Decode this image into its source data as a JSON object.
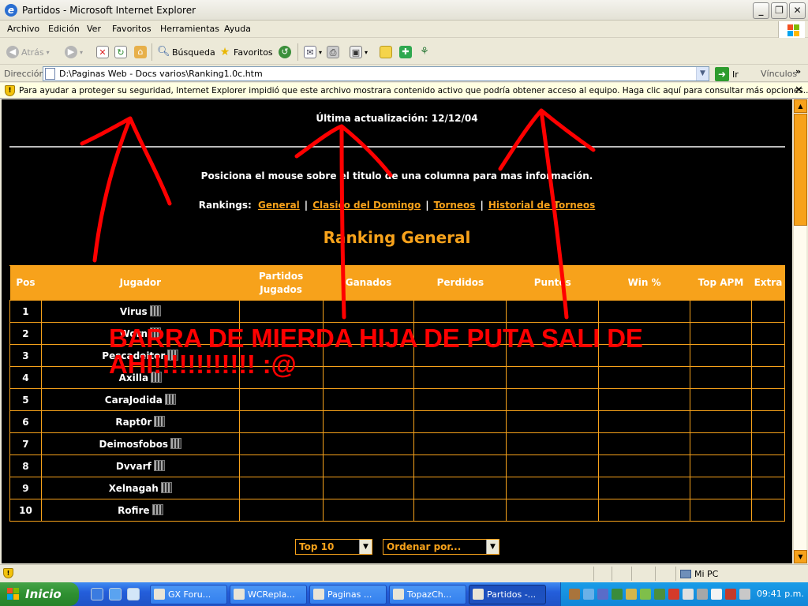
{
  "window": {
    "title": "Partidos - Microsoft Internet Explorer"
  },
  "menu": [
    "Archivo",
    "Edición",
    "Ver",
    "Favoritos",
    "Herramientas",
    "Ayuda"
  ],
  "toolbar": {
    "back": "Atrás",
    "search": "Búsqueda",
    "favorites": "Favoritos"
  },
  "address": {
    "label": "Dirección",
    "value": "D:\\Paginas Web - Docs varios\\Ranking1.0c.htm",
    "go": "Ir",
    "links": "Vínculos"
  },
  "infobar": {
    "text": "Para ayudar a proteger su seguridad, Internet Explorer impidió que este archivo mostrara contenido activo que podría obtener acceso al equipo. Haga clic aquí para consultar más opciones..."
  },
  "page": {
    "updated": "Última actualización: 12/12/04",
    "hint": "Posiciona el mouse sobre el titulo de una columna para mas información.",
    "rankings_label": "Rankings:",
    "links": [
      "General",
      "Clasico del Domingo",
      "Torneos",
      "Historial de Torneos"
    ],
    "title": "Ranking General",
    "columns": [
      "Pos",
      "Jugador",
      "Partidos Jugados",
      "Ganados",
      "Perdidos",
      "Puntos",
      "Win %",
      "Top APM",
      "Extra"
    ],
    "rows": [
      {
        "pos": "1",
        "player": "Virus"
      },
      {
        "pos": "2",
        "player": "Worn"
      },
      {
        "pos": "3",
        "player": "Pescadeitor"
      },
      {
        "pos": "4",
        "player": "Axilla"
      },
      {
        "pos": "5",
        "player": "CaraJodida"
      },
      {
        "pos": "6",
        "player": "Rapt0r"
      },
      {
        "pos": "7",
        "player": "Deimosfobos"
      },
      {
        "pos": "8",
        "player": "Dvvarf"
      },
      {
        "pos": "9",
        "player": "Xelnagah"
      },
      {
        "pos": "10",
        "player": "Rofire"
      }
    ],
    "select_top": "Top 10",
    "select_order": "Ordenar por..."
  },
  "overlay": {
    "text": "BARRA DE MIERDA HIJA DE PUTA SALI DE AHI!!!!!!!!!!!! :@"
  },
  "statusbar": {
    "zone": "Mi PC"
  },
  "taskbar": {
    "start": "Inicio",
    "tasks": [
      "GX Foru...",
      "WCReplа...",
      "Paginas ...",
      "TopazCh...",
      "Partidos -..."
    ],
    "clock": "09:41 p.m."
  },
  "colors": {
    "accent": "#f7a21b",
    "scribble": "#ff0000"
  }
}
